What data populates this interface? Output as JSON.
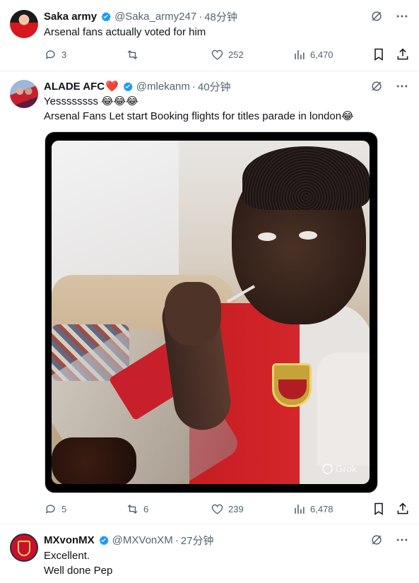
{
  "posts": [
    {
      "name": "Saka army",
      "handle": "@Saka_army247",
      "time": "48分钟",
      "text_lines": [
        "Arsenal fans actually voted for him"
      ],
      "replies": "3",
      "reposts": "",
      "likes": "252",
      "views": "6,470"
    },
    {
      "name": "ALADE AFC",
      "name_emoji": "❤️",
      "handle": "@mlekanm",
      "time": "40分钟",
      "text_lines": [
        "Yessssssss 😂😂😂",
        "Arsenal Fans Let start Booking flights for titles parade in london😂"
      ],
      "media_watermark": "Grok",
      "replies": "5",
      "reposts": "6",
      "likes": "239",
      "views": "6,478"
    },
    {
      "name": "MXvonMX",
      "handle": "@MXVonXM",
      "time": "27分钟",
      "text_lines": [
        "Excellent.",
        "Well done Pep"
      ]
    }
  ],
  "colors": {
    "verified": "#1d9bf0",
    "secondary_text": "#536471",
    "divider": "#eff3f4"
  },
  "icons": [
    "verified-badge-icon",
    "grok-icon",
    "more-icon",
    "reply-icon",
    "repost-icon",
    "like-icon",
    "views-icon",
    "bookmark-icon",
    "share-icon"
  ]
}
